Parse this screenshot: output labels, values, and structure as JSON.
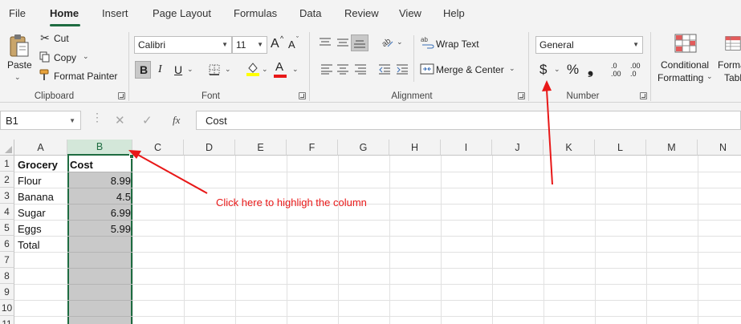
{
  "menu": {
    "tabs": [
      {
        "label": "File"
      },
      {
        "label": "Home"
      },
      {
        "label": "Insert"
      },
      {
        "label": "Page Layout"
      },
      {
        "label": "Formulas"
      },
      {
        "label": "Data"
      },
      {
        "label": "Review"
      },
      {
        "label": "View"
      },
      {
        "label": "Help"
      }
    ],
    "active": "Home"
  },
  "ribbon": {
    "clipboard": {
      "paste_label": "Paste",
      "cut_label": "Cut",
      "copy_label": "Copy",
      "format_painter_label": "Format Painter",
      "group_label": "Clipboard"
    },
    "font": {
      "font_name": "Calibri",
      "font_size": "11",
      "grow_label": "A",
      "shrink_label": "A",
      "bold_label": "B",
      "italic_label": "I",
      "underline_label": "U",
      "font_color_label": "A",
      "fill_color": "#ffff00",
      "font_color": "#e81818",
      "group_label": "Font"
    },
    "alignment": {
      "wrap_text_label": "Wrap Text",
      "merge_center_label": "Merge & Center",
      "group_label": "Alignment"
    },
    "number": {
      "format_value": "General",
      "currency_symbol": "$",
      "percent_symbol": "%",
      "comma_symbol": "❟",
      "increase_decimal_top": ".0",
      "increase_decimal_bottom": ".00",
      "decrease_decimal_top": ".00",
      "decrease_decimal_bottom": ".0",
      "group_label": "Number"
    },
    "styles": {
      "conditional_formatting_line1": "Conditional",
      "conditional_formatting_line2": "Formatting",
      "format_as_table_line1": "Forma",
      "format_as_table_line2": "Table"
    }
  },
  "formula_bar": {
    "name_box": "B1",
    "cancel_symbol": "✕",
    "enter_symbol": "✓",
    "fx_label": "fx",
    "content": "Cost"
  },
  "sheet": {
    "columns": [
      "A",
      "B",
      "C",
      "D",
      "E",
      "F",
      "G",
      "H",
      "I",
      "J",
      "K",
      "L",
      "M",
      "N"
    ],
    "selected_column": "B",
    "rows": [
      "1",
      "2",
      "3",
      "4",
      "5",
      "6",
      "7",
      "8",
      "9",
      "10",
      "11"
    ],
    "cells": {
      "A1": "Grocery",
      "B1": "Cost",
      "A2": "Flour",
      "B2": "8.99",
      "A3": "Banana",
      "B3": "4.5",
      "A4": "Sugar",
      "B4": "6.99",
      "A5": "Eggs",
      "B5": "5.99",
      "A6": "Total"
    }
  },
  "annotation": {
    "text": "Click here to highligh the column",
    "color": "#e81818"
  },
  "accent_color": "#1e6c41"
}
